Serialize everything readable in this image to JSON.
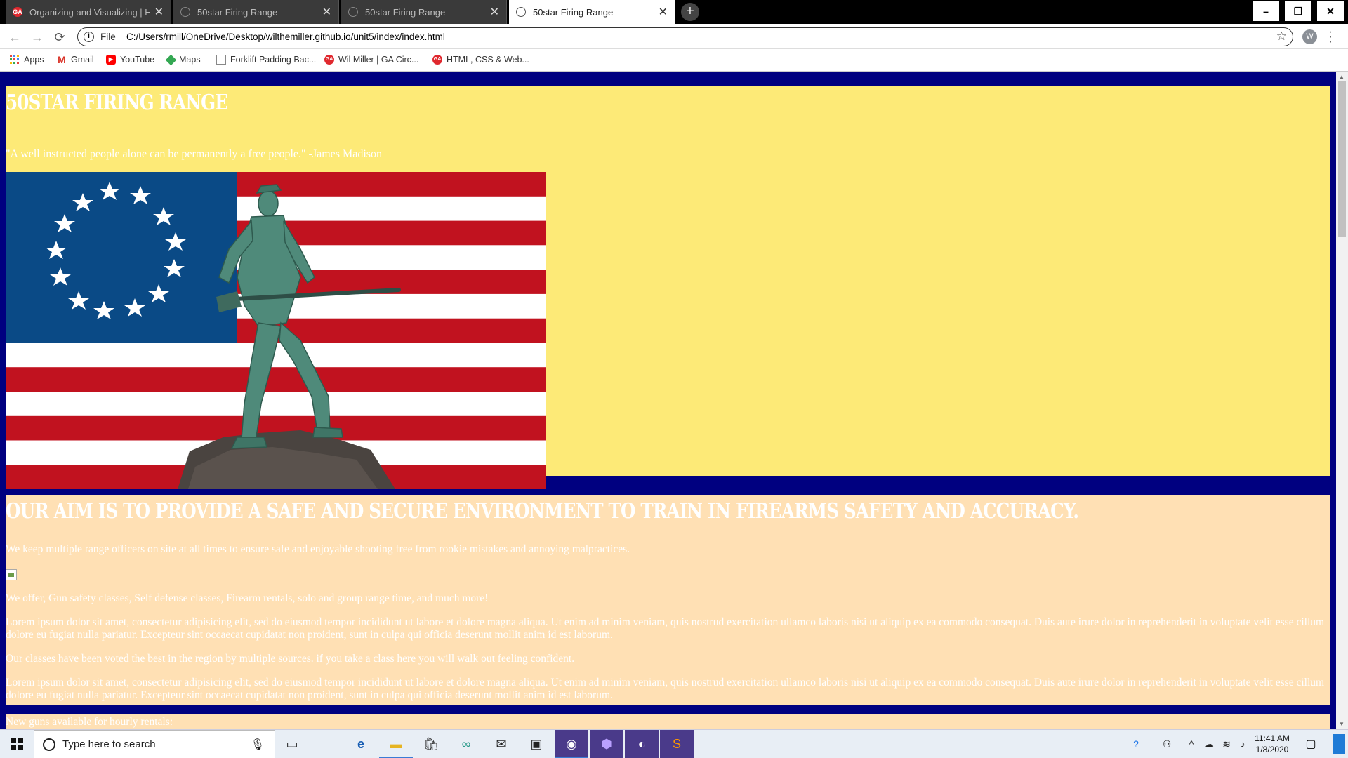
{
  "browser": {
    "tabs": [
      {
        "title": "Organizing and Visualizing | HTM",
        "favicon": "ga-logo-icon"
      },
      {
        "title": "50star Firing Range",
        "favicon": "globe-icon"
      },
      {
        "title": "50star Firing Range",
        "favicon": "globe-icon"
      },
      {
        "title": "50star Firing Range",
        "favicon": "globe-icon"
      }
    ],
    "new_tab_label": "+",
    "window_controls": {
      "minimize": "–",
      "restore": "❐",
      "close": "✕"
    },
    "nav": {
      "back": "←",
      "forward": "→",
      "reload": "⟳"
    },
    "omnibox": {
      "info": "i",
      "scheme_label": "File",
      "url": "C:/Users/rmill/OneDrive/Desktop/wilthemiller.github.io/unit5/index/index.html"
    },
    "profile_initial": "W",
    "bookmarks": [
      {
        "label": "Apps",
        "icon": "apps-grid-icon",
        "color": "#e8453c"
      },
      {
        "label": "Gmail",
        "icon": "gmail-icon",
        "color": "#d93025"
      },
      {
        "label": "YouTube",
        "icon": "youtube-icon",
        "color": "#ff0000"
      },
      {
        "label": "Maps",
        "icon": "maps-icon",
        "color": "#34a853"
      },
      {
        "label": "Forklift Padding Bac...",
        "icon": "page-icon",
        "color": "#888888"
      },
      {
        "label": "Wil Miller | GA Circ...",
        "icon": "ga-logo-icon",
        "color": "#e0282e"
      },
      {
        "label": "HTML, CSS & Web...",
        "icon": "ga-logo-icon",
        "color": "#e0282e"
      }
    ]
  },
  "page": {
    "colors": {
      "body_bg": "#000080",
      "section1_bg": "#fdea77",
      "section2_bg": "#ffe0b4",
      "text": "#ffffff"
    },
    "header": {
      "title": "50STAR FIRING RANGE",
      "quote": "\"A well instructed people alone can be permanently a free people.\" -James Madison"
    },
    "about": {
      "heading": "OUR AIM IS TO PROVIDE A SAFE AND SECURE ENVIRONMENT TO TRAIN IN FIREARMS SAFETY AND ACCURACY.",
      "p1": "We keep multiple range officers on site at all times to ensure safe and enjoyable shooting free from rookie mistakes and annoying malpractices.",
      "p2": "We offer, Gun safety classes, Self defense classes, Firearm rentals, solo and group range time, and much more!",
      "lorem1": "Lorem ipsum dolor sit amet, consectetur adipisicing elit, sed do eiusmod tempor incididunt ut labore et dolore magna aliqua. Ut enim ad minim veniam, quis nostrud exercitation ullamco laboris nisi ut aliquip ex ea commodo consequat. Duis aute irure dolor in reprehenderit in voluptate velit esse cillum dolore eu fugiat nulla pariatur. Excepteur sint occaecat cupidatat non proident, sunt in culpa qui officia deserunt mollit anim id est laborum.",
      "p3": "Our classes have been voted the best in the region by multiple sources. if you take a class here you will walk out feeling confident.",
      "lorem2": "Lorem ipsum dolor sit amet, consectetur adipisicing elit, sed do eiusmod tempor incididunt ut labore et dolore magna aliqua. Ut enim ad minim veniam, quis nostrud exercitation ullamco laboris nisi ut aliquip ex ea commodo consequat. Duis aute irure dolor in reprehenderit in voluptate velit esse cillum dolore eu fugiat nulla pariatur. Excepteur sint occaecat cupidatat non proident, sunt in culpa qui officia deserunt mollit anim id est laborum."
    },
    "rentals": {
      "text": "New guns available for hourly rentals:"
    }
  },
  "taskbar": {
    "search_placeholder": "Type here to search",
    "time": "11:41 AM",
    "date": "1/8/2020"
  }
}
